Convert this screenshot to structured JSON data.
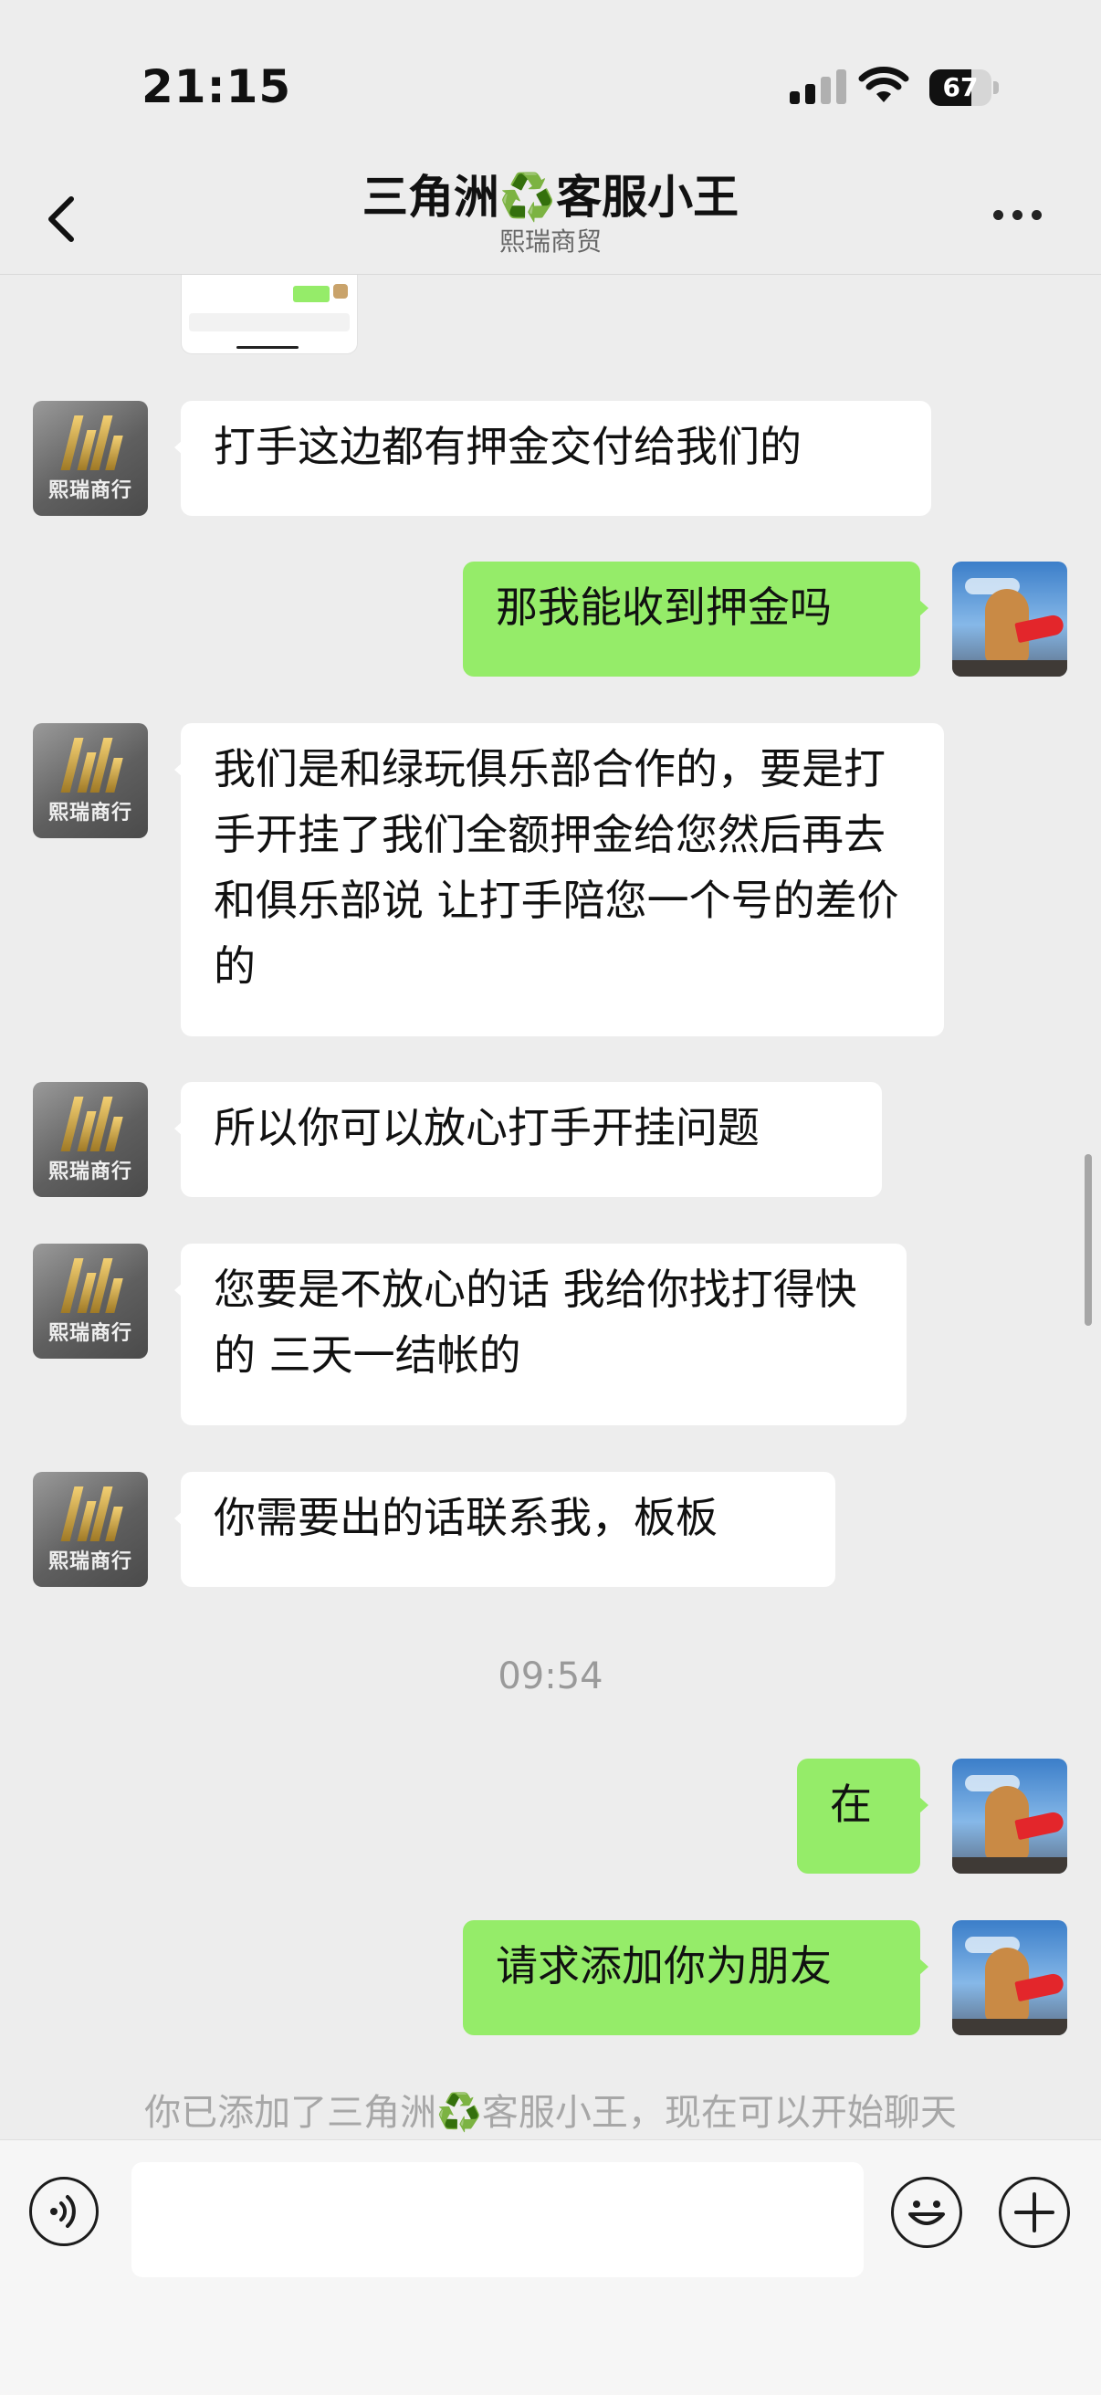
{
  "status_bar": {
    "time": "21:15",
    "battery": "67",
    "battery_level": 0.67
  },
  "header": {
    "back_icon": "chevron-left-icon",
    "title_a": "三角洲",
    "title_icon": "♻️",
    "title_b": "客服小王",
    "subtitle": "熙瑞商贸",
    "more_icon": "ellipsis-icon"
  },
  "contact_avatar": {
    "caption": "熙瑞商行"
  },
  "messages": [
    {
      "side": "in",
      "text": "打手这边都有押金交付给我们的"
    },
    {
      "side": "out",
      "text": "那我能收到押金吗"
    },
    {
      "side": "in",
      "text": "我们是和绿玩俱乐部合作的，要是打手开挂了我们全额押金给您然后再去和俱乐部说  让打手陪您一个号的差价的"
    },
    {
      "side": "in",
      "text": "所以你可以放心打手开挂问题"
    },
    {
      "side": "in",
      "text": "您要是不放心的话  我给你找打得快的  三天一结帐的"
    },
    {
      "side": "in",
      "text": "你需要出的话联系我，板板"
    },
    {
      "side": "out",
      "text": "在"
    },
    {
      "side": "out",
      "text": "请求添加你为朋友"
    }
  ],
  "timestamp": "09:54",
  "system_message": {
    "before": "你已添加了三角洲",
    "icon": "♻️",
    "after": "客服小王，现在可以开始聊天"
  },
  "input_bar": {
    "voice_icon": "voice-icon",
    "emoji_icon": "smile-icon",
    "plus_icon": "plus-icon",
    "value": ""
  },
  "colors": {
    "background": "#ededed",
    "outgoing_bubble": "#95ec69",
    "incoming_bubble": "#ffffff"
  }
}
